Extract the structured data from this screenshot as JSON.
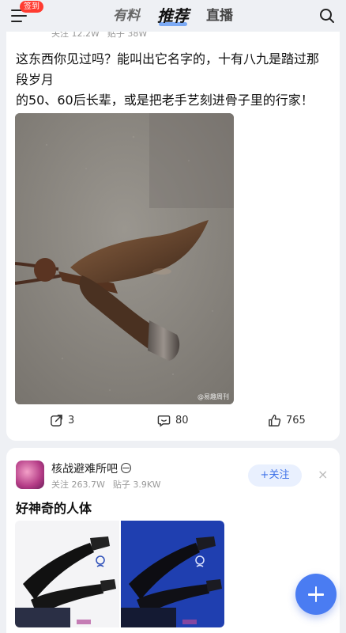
{
  "topbar": {
    "badge": "签到",
    "tabs": [
      "有料",
      "推荐",
      "直播"
    ],
    "active_tab": "推荐"
  },
  "post1": {
    "stats": {
      "followers": "关注 12.2W",
      "posts": "贴子 38W"
    },
    "title_line1": "这东西你见过吗？能叫出它名字的，十有八九是踏过那段岁月",
    "title_line2": "的50、60后长辈，或是把老手艺刻进骨子里的行家！",
    "image_watermark": "@易趣周刊",
    "actions": {
      "shares": "3",
      "comments": "80",
      "likes": "765"
    }
  },
  "post2": {
    "forum_name": "核战避难所吧",
    "stats": {
      "followers": "关注 263.7W",
      "posts": "贴子 3.9KW"
    },
    "follow_label": "+关注",
    "title": "好神奇的人体"
  },
  "icons": {
    "menu": "menu-icon",
    "search": "search-icon",
    "share": "share-icon",
    "comment": "comment-icon",
    "like": "like-icon",
    "close": "close-icon",
    "fab": "plus-icon"
  },
  "colors": {
    "accent": "#4a7cf2",
    "badge": "#ff3b30",
    "follow_bg": "#e9f0fe"
  }
}
